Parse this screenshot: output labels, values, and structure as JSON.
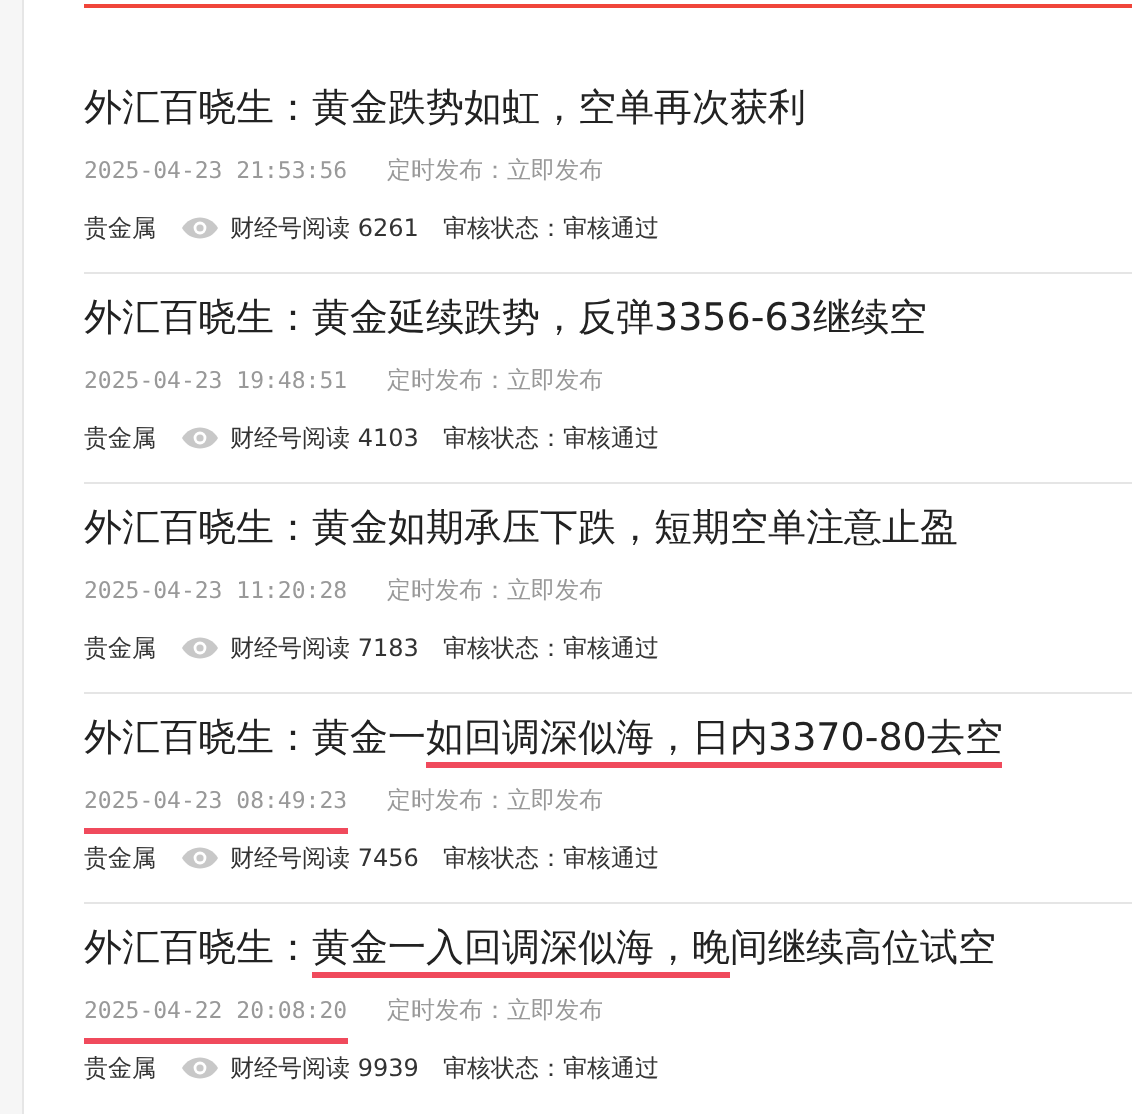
{
  "articles": [
    {
      "title": [
        {
          "text": "外汇百晓生：黄金跌势如虹，空单再次获利",
          "underlined": false
        }
      ],
      "date": "2025-04-23 21:53:56",
      "date_underlined": false,
      "schedule": "定时发布：立即发布",
      "category": "贵金属",
      "reads": "财经号阅读 6261",
      "review": "审核状态：审核通过"
    },
    {
      "title": [
        {
          "text": "外汇百晓生：黄金延续跌势，反弹3356-63继续空",
          "underlined": false
        }
      ],
      "date": "2025-04-23 19:48:51",
      "date_underlined": false,
      "schedule": "定时发布：立即发布",
      "category": "贵金属",
      "reads": "财经号阅读 4103",
      "review": "审核状态：审核通过"
    },
    {
      "title": [
        {
          "text": "外汇百晓生：黄金如期承压下跌，短期空单注意止盈",
          "underlined": false
        }
      ],
      "date": "2025-04-23 11:20:28",
      "date_underlined": false,
      "schedule": "定时发布：立即发布",
      "category": "贵金属",
      "reads": "财经号阅读 7183",
      "review": "审核状态：审核通过"
    },
    {
      "title": [
        {
          "text": "外汇百晓生：黄金一",
          "underlined": false
        },
        {
          "text": "如回调深似海，日内3370-80去空",
          "underlined": true
        }
      ],
      "date": "2025-04-23 08:49:23",
      "date_underlined": true,
      "schedule": "定时发布：立即发布",
      "category": "贵金属",
      "reads": "财经号阅读 7456",
      "review": "审核状态：审核通过"
    },
    {
      "title": [
        {
          "text": "外汇百晓生：",
          "underlined": false
        },
        {
          "text": "黄金一入回调深似海，晚",
          "underlined": true
        },
        {
          "text": "间继续高位试空",
          "underlined": false
        }
      ],
      "date": "2025-04-22 20:08:20",
      "date_underlined": true,
      "schedule": "定时发布：立即发布",
      "category": "贵金属",
      "reads": "财经号阅读 9939",
      "review": "审核状态：审核通过"
    }
  ]
}
